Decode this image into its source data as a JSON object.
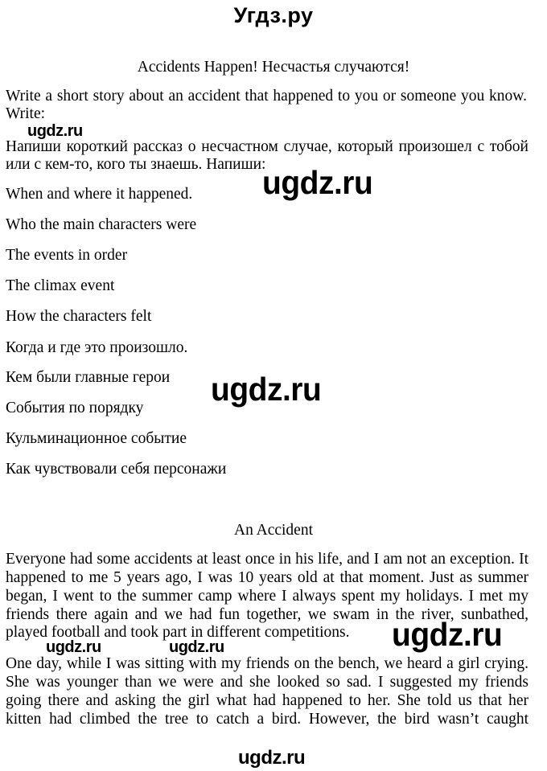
{
  "site_title": "Угдз.ру",
  "task_title": "Accidents Happen!  Несчастья случаются!",
  "instructions": {
    "en_line1": "Write a short story about an accident that happened to you or someone you know.",
    "en_line2": "Write:",
    "ru_line1": "Напиши короткий рассказ о несчастном случае, который произошел с тобой",
    "ru_line2": "или с кем-то, кого ты знаешь. Напиши:"
  },
  "checklist_en": [
    "When and where it happened.",
    "Who the main characters were",
    "The events in order",
    "The climax event",
    "How the characters felt"
  ],
  "checklist_ru": [
    "Когда и где это произошло.",
    "Кем были главные герои",
    "События по порядку",
    "Кульминационное событие",
    "Как чувствовали себя персонажи"
  ],
  "story": {
    "title": "An Accident",
    "paragraph1_lines": [
      "Everyone had some accidents at least once in his life, and I am not an exception. It",
      "happened to me 5 years ago, I was 10 years old at that moment. Just as summer",
      "began, I went to the summer camp where I always spent my holidays. I met my",
      "friends there again and we had fun together, we swam in the river, sunbathed,",
      "played football and took part in different competitions."
    ],
    "paragraph2_lines": [
      "One day, while I was sitting with my friends on the bench, we heard a girl crying.",
      "She was younger than we were and she looked so sad. I suggested my friends",
      "going there and asking the girl what had happened to her. She told us that her",
      "kitten had climbed the tree to catch a bird. However, the bird wasn’t caught"
    ]
  },
  "watermarks": {
    "text": "ugdz.ru"
  }
}
